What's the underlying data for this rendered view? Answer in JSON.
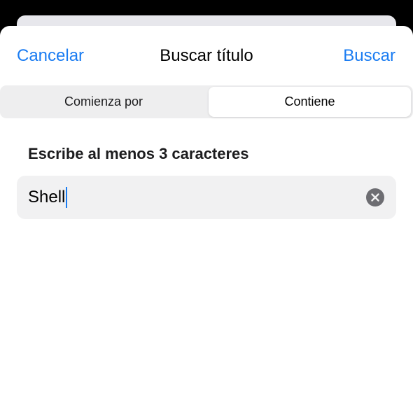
{
  "nav": {
    "cancel_label": "Cancelar",
    "title": "Buscar título",
    "search_label": "Buscar",
    "accent_color": "#1a7cf2"
  },
  "segmented_control": {
    "options": [
      "Comienza por",
      "Contiene"
    ],
    "selected": "Contiene"
  },
  "hint": "Escribe al menos 3 caracteres",
  "search_field": {
    "value": "Shell",
    "clear_icon": "xmark-circle-fill-icon"
  }
}
